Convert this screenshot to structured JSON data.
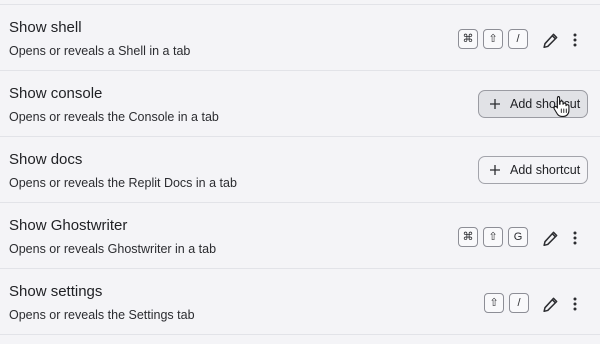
{
  "commands": [
    {
      "title": "Show shell",
      "description": "Opens or reveals a Shell in a tab",
      "keys": [
        "⌘",
        "⇧",
        "/"
      ]
    },
    {
      "title": "Show console",
      "description": "Opens or reveals the Console in a tab",
      "add_label": "Add shortcut"
    },
    {
      "title": "Show docs",
      "description": "Opens or reveals the Replit Docs in a tab",
      "add_label": "Add shortcut"
    },
    {
      "title": "Show Ghostwriter",
      "description": "Opens or reveals Ghostwriter in a tab",
      "keys": [
        "⌘",
        "⇧",
        "G"
      ]
    },
    {
      "title": "Show settings",
      "description": "Opens or reveals the Settings tab",
      "keys": [
        "⇧",
        "/"
      ]
    }
  ],
  "icons": {
    "edit": "pencil-icon",
    "more": "more-vertical-icon",
    "add": "plus-icon",
    "cursor": "pointer-hand-cursor"
  },
  "colors": {
    "background": "#f4f4f7",
    "separator": "#e2e3e8",
    "key_border": "#8d8e96",
    "button_hover": "#e1e2e6"
  }
}
